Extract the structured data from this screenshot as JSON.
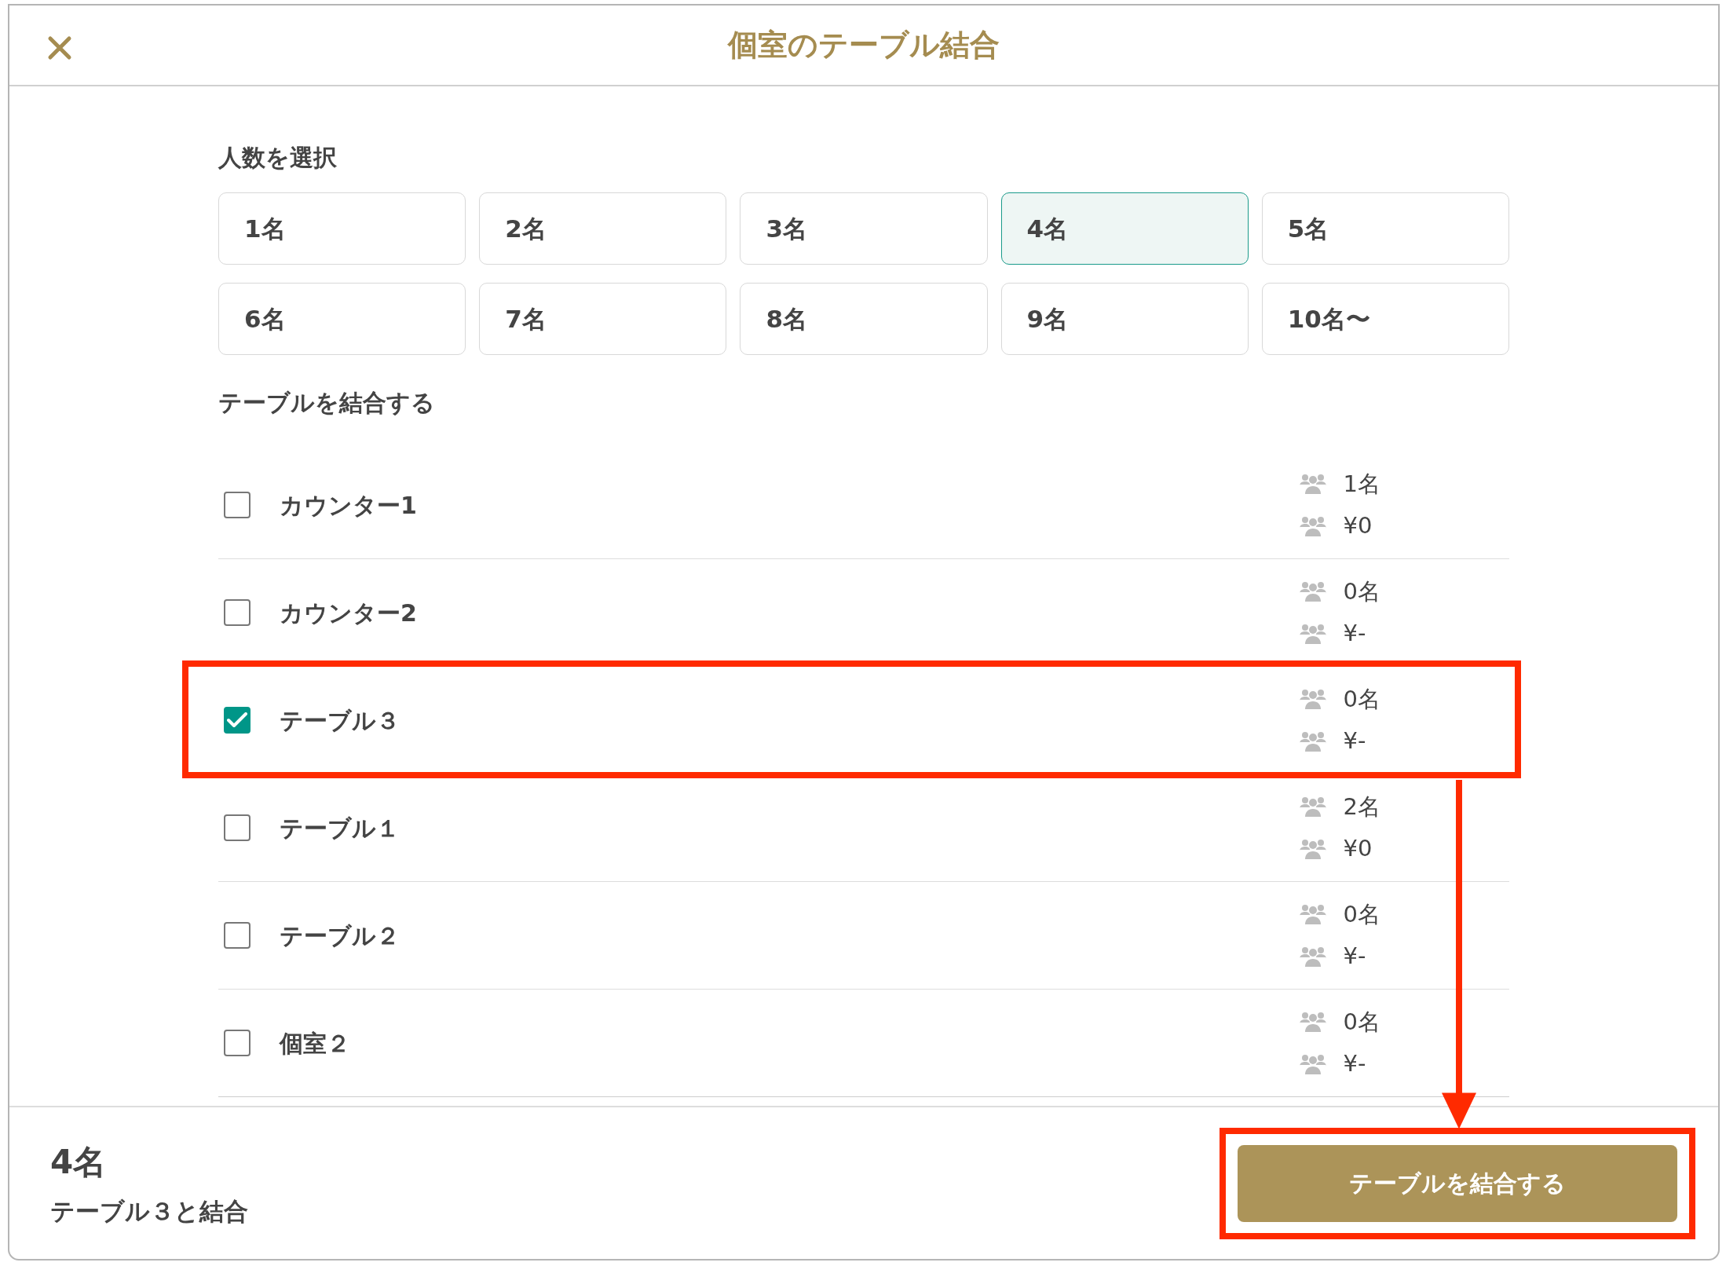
{
  "dialog": {
    "title": "個室のテーブル結合"
  },
  "party_size": {
    "label": "人数を選択",
    "options": [
      {
        "label": "1名",
        "selected": false
      },
      {
        "label": "2名",
        "selected": false
      },
      {
        "label": "3名",
        "selected": false
      },
      {
        "label": "4名",
        "selected": true
      },
      {
        "label": "5名",
        "selected": false
      },
      {
        "label": "6名",
        "selected": false
      },
      {
        "label": "7名",
        "selected": false
      },
      {
        "label": "8名",
        "selected": false
      },
      {
        "label": "9名",
        "selected": false
      },
      {
        "label": "10名〜",
        "selected": false
      }
    ]
  },
  "tables": {
    "label": "テーブルを結合する",
    "rows": [
      {
        "name": "カウンター1",
        "checked": false,
        "guests": "1名",
        "amount": "¥0",
        "highlighted": false
      },
      {
        "name": "カウンター2",
        "checked": false,
        "guests": "0名",
        "amount": "¥-",
        "highlighted": false
      },
      {
        "name": "テーブル３",
        "checked": true,
        "guests": "0名",
        "amount": "¥-",
        "highlighted": true
      },
      {
        "name": "テーブル１",
        "checked": false,
        "guests": "2名",
        "amount": "¥0",
        "highlighted": false
      },
      {
        "name": "テーブル２",
        "checked": false,
        "guests": "0名",
        "amount": "¥-",
        "highlighted": false
      },
      {
        "name": "個室２",
        "checked": false,
        "guests": "0名",
        "amount": "¥-",
        "highlighted": false
      }
    ]
  },
  "footer": {
    "count": "4名",
    "summary": "テーブル３と結合",
    "button": {
      "label": "テーブルを結合する",
      "highlighted": true
    }
  }
}
